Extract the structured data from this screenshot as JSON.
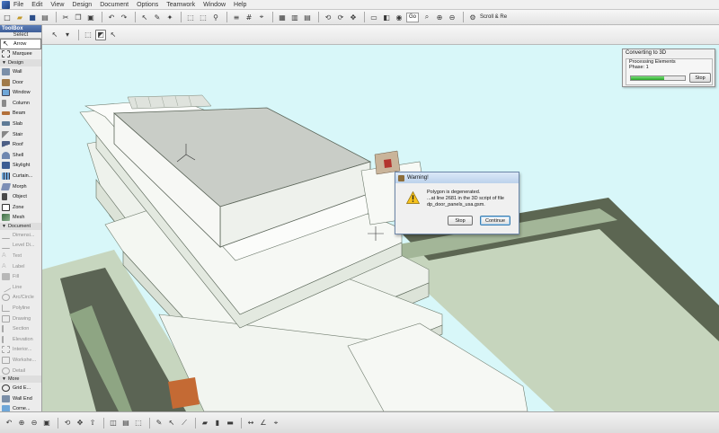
{
  "menu": [
    "File",
    "Edit",
    "View",
    "Design",
    "Document",
    "Options",
    "Teamwork",
    "Window",
    "Help"
  ],
  "toolbar": {
    "zoom_combo": "Go",
    "scroll_button": "Scroll & Re"
  },
  "toolbox": {
    "title": "ToolBox",
    "select_label": "Select",
    "select_tools": [
      "Arrow",
      "Marquee"
    ],
    "design_header": "Design",
    "design_tools": [
      "Wall",
      "Door",
      "Window",
      "Column",
      "Beam",
      "Slab",
      "Stair",
      "Roof",
      "Shell",
      "Skylight",
      "Curtain...",
      "Morph",
      "Object",
      "Zone",
      "Mesh"
    ],
    "document_header": "Document",
    "document_tools": [
      "Dimensi...",
      "Level Di...",
      "Text",
      "Label",
      "Fill",
      "Line",
      "Arc/Circle",
      "Polyline",
      "Drawing",
      "Section",
      "Elevation",
      "Interior...",
      "Workshe...",
      "Detail"
    ],
    "more_header": "More",
    "more_tools": [
      "Grid E...",
      "Wall End",
      "Corne..."
    ]
  },
  "progress": {
    "title": "Converting to 3D",
    "line1": "Processing Elements",
    "line2": "Phase: 1",
    "fill": 0.62,
    "stop_label": "Stop"
  },
  "dialog": {
    "title": "Warning!",
    "line1": "Polygon is degenerated.",
    "line2": "...at line 2681 in the 3D script of file",
    "line3": "dp_door_panels_usa.gsm.",
    "stop_label": "Stop",
    "continue_label": "Continue"
  },
  "colors": {
    "sky": "#d8f7f9",
    "ground": "#c7d6bf",
    "road": "#5b6454",
    "building": "#f4f7f2",
    "progress_fill": "#28a428"
  }
}
